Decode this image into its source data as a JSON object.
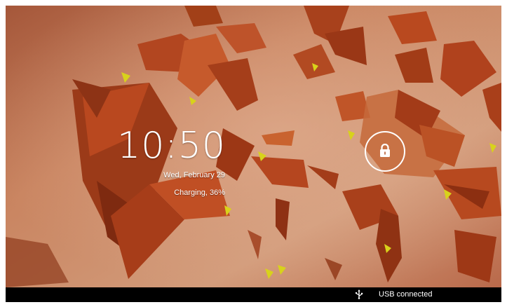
{
  "lockscreen": {
    "time": "10:50",
    "date": "Wed, February 29",
    "charging": "Charging, 36%",
    "unlock_icon": "padlock-icon"
  },
  "status_bar": {
    "usb_icon": "usb-icon",
    "notification": "USB connected"
  },
  "colors": {
    "wallpaper_base": "#c47a57",
    "shard_dark": "#9b2f12",
    "shard_mid": "#b8441d",
    "shard_light": "#d06a3e",
    "accent_yellow": "#d8d21b",
    "status_bar_bg": "#000000",
    "text": "#ffffff"
  }
}
